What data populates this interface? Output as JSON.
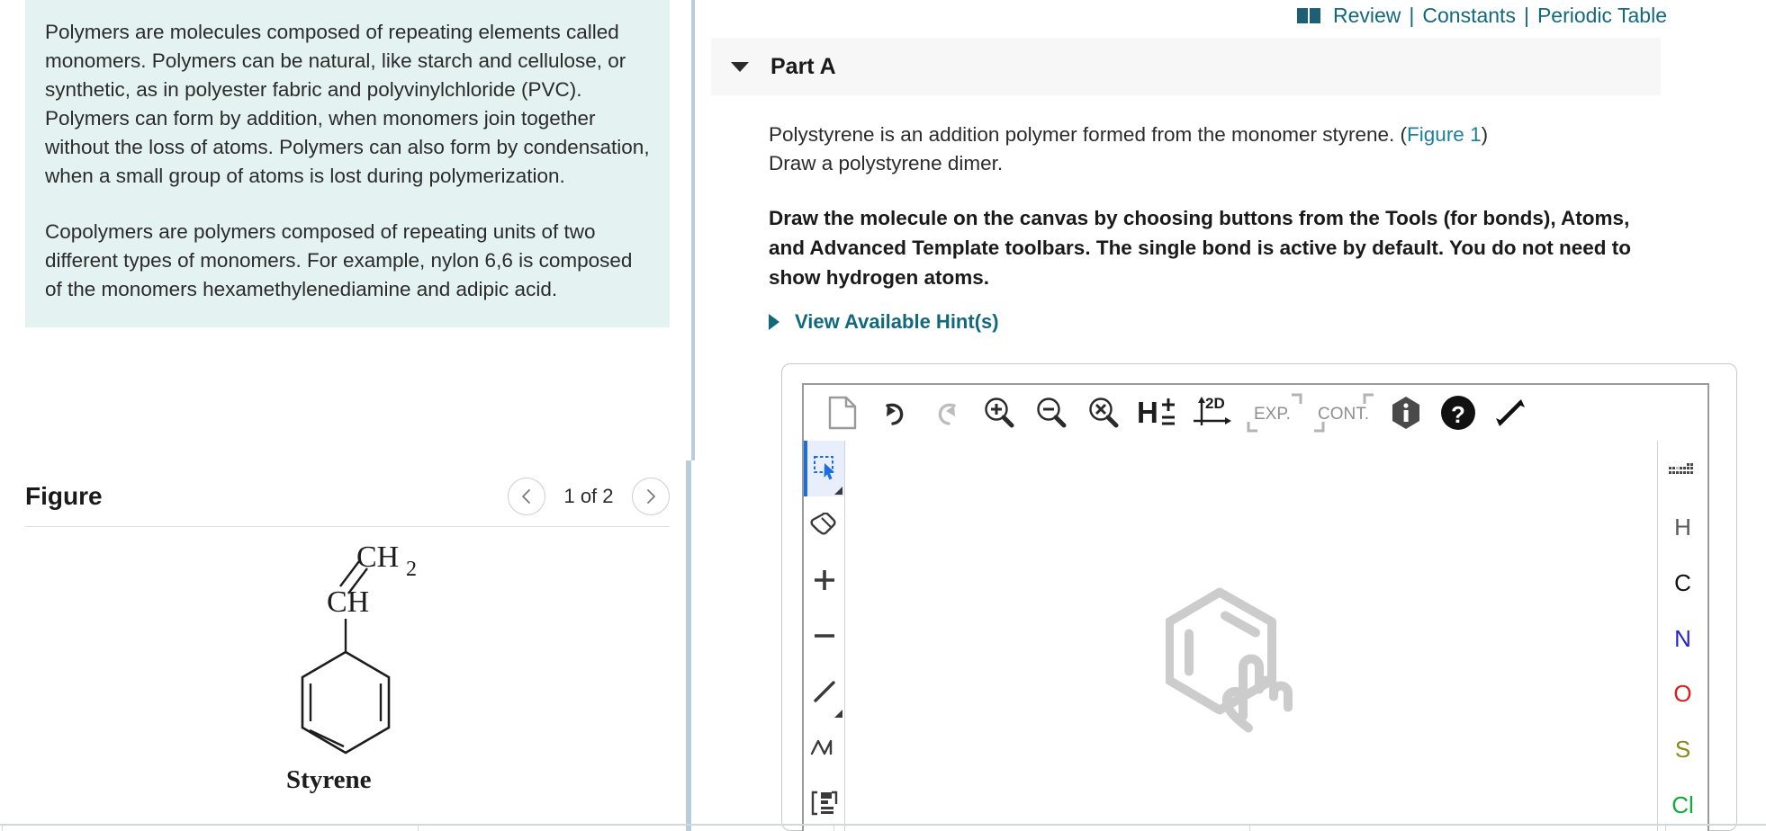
{
  "left": {
    "intro_paragraph_1": "Polymers are molecules composed of repeating elements called monomers. Polymers can be natural, like starch and cellulose, or synthetic, as in polyester fabric and polyvinylchloride (PVC).",
    "intro_paragraph_2": "Polymers can form by addition, when monomers join together without the loss of atoms. Polymers can also form by condensation, when a small group of atoms is lost during polymerization.",
    "intro_paragraph_3": "Copolymers are polymers composed of repeating units of two different types of monomers. For example, nylon 6,6 is composed of the monomers hexamethylenediamine and adipic acid.",
    "figure_title": "Figure",
    "figure_count": "1 of 2",
    "prev_icon": "chevron-left-icon",
    "next_icon": "chevron-right-icon",
    "molecule": {
      "label_ch2": "CH",
      "label_ch2_sub": "2",
      "label_ch": "CH",
      "name": "Styrene"
    },
    "background_color": "#e4f2f1"
  },
  "right": {
    "toplinks": {
      "book_icon": "book-icon",
      "review": "Review",
      "separator": "|",
      "constants": "Constants",
      "periodic_table": "Periodic Table",
      "color": "#12697e"
    },
    "part": {
      "caret_icon": "caret-down-icon",
      "title": "Part A"
    },
    "question": {
      "line1_a": "Polystyrene is an addition polymer formed from the monomer styrene. (",
      "line1_link": "Figure 1",
      "line1_b": ")",
      "line2": "Draw a polystyrene dimer.",
      "instructions": "Draw the molecule on the canvas by choosing buttons from the Tools (for bonds), Atoms, and Advanced Template toolbars. The single bond is active by default. You do not need to show hydrogen atoms."
    },
    "hints": {
      "caret_icon": "caret-right-icon",
      "label": "View Available Hint(s)",
      "color": "#12697e"
    },
    "drawing": {
      "toolbar": [
        {
          "name": "new-document-icon",
          "label": ""
        },
        {
          "name": "undo-icon",
          "label": ""
        },
        {
          "name": "redo-icon",
          "label": ""
        },
        {
          "name": "zoom-in-icon",
          "label": ""
        },
        {
          "name": "zoom-out-icon",
          "label": ""
        },
        {
          "name": "zoom-reset-icon",
          "label": ""
        },
        {
          "name": "hydrogen-toggle-icon",
          "label": "H"
        },
        {
          "name": "two-d-layout-icon",
          "label": "2D"
        },
        {
          "name": "expand-template-icon",
          "label": "EXP."
        },
        {
          "name": "contract-template-icon",
          "label": "CONT."
        },
        {
          "name": "info-icon",
          "label": ""
        },
        {
          "name": "help-icon",
          "label": ""
        },
        {
          "name": "fullscreen-icon",
          "label": ""
        }
      ],
      "tools": [
        {
          "name": "select-tool-icon",
          "active": true
        },
        {
          "name": "eraser-tool-icon",
          "active": false
        },
        {
          "name": "increase-charge-tool-icon",
          "active": false
        },
        {
          "name": "decrease-charge-tool-icon",
          "active": false
        },
        {
          "name": "single-bond-tool-icon",
          "active": false
        },
        {
          "name": "chain-tool-icon",
          "active": false
        },
        {
          "name": "bracket-tool-icon",
          "active": false
        }
      ],
      "atoms": [
        {
          "label": "",
          "name": "periodic-table-icon",
          "color": "#4a4a4a"
        },
        {
          "label": "H",
          "name": "atom-hydrogen",
          "color": "#595959"
        },
        {
          "label": "C",
          "name": "atom-carbon",
          "color": "#111111"
        },
        {
          "label": "N",
          "name": "atom-nitrogen",
          "color": "#2626c8"
        },
        {
          "label": "O",
          "name": "atom-oxygen",
          "color": "#e01b1b"
        },
        {
          "label": "S",
          "name": "atom-sulfur",
          "color": "#8a8a12"
        },
        {
          "label": "Cl",
          "name": "atom-chlorine",
          "color": "#12a83c"
        }
      ],
      "canvas_watermark_icon": "hexagon-tap-watermark-icon"
    }
  }
}
